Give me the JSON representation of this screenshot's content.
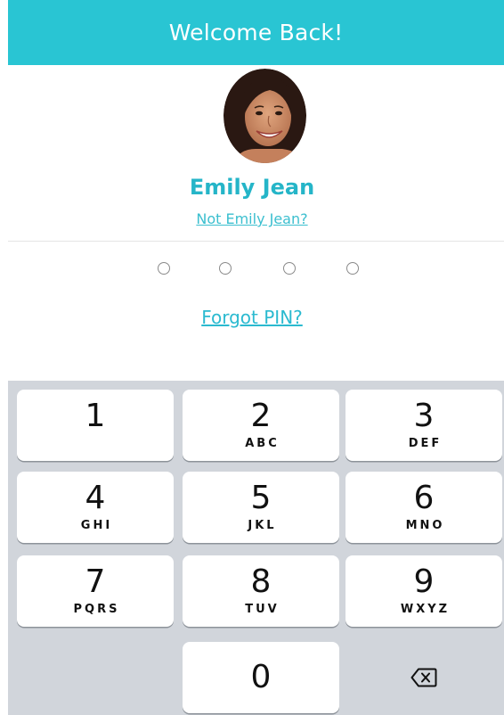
{
  "header": {
    "title": "Welcome Back!",
    "color": "#29c5d3"
  },
  "user": {
    "name": "Emily Jean",
    "switch_link": "Not Emily Jean?"
  },
  "pin": {
    "length": 4,
    "entered": 0
  },
  "forgot_link": "Forgot PIN?",
  "keypad": {
    "keys": [
      {
        "digit": "1",
        "letters": ""
      },
      {
        "digit": "2",
        "letters": "ABC"
      },
      {
        "digit": "3",
        "letters": "DEF"
      },
      {
        "digit": "4",
        "letters": "GHI"
      },
      {
        "digit": "5",
        "letters": "JKL"
      },
      {
        "digit": "6",
        "letters": "MNO"
      },
      {
        "digit": "7",
        "letters": "PQRS"
      },
      {
        "digit": "8",
        "letters": "TUV"
      },
      {
        "digit": "9",
        "letters": "WXYZ"
      },
      {
        "digit": "0",
        "letters": ""
      }
    ],
    "backspace_icon": "backspace-icon"
  }
}
